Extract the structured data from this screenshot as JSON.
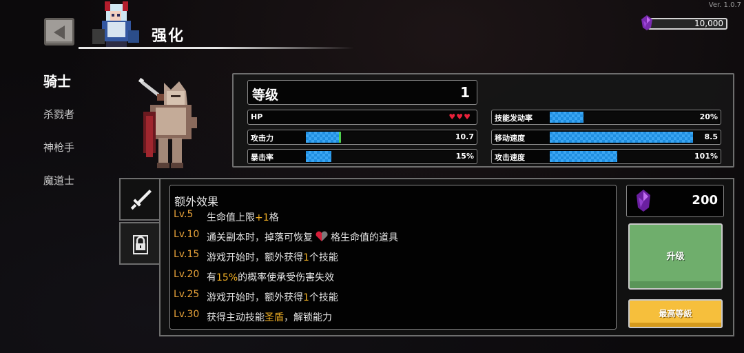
{
  "version": "Ver. 1.0.7",
  "header": {
    "title": "强化"
  },
  "currency": {
    "amount": "10,000",
    "icon": "purple-gem-icon"
  },
  "classes": [
    {
      "label": "骑士",
      "active": true
    },
    {
      "label": "杀戮者",
      "active": false
    },
    {
      "label": "神枪手",
      "active": false
    },
    {
      "label": "魔道士",
      "active": false
    }
  ],
  "stats": {
    "level_label": "等级",
    "level_value": "1",
    "hp": {
      "label": "HP",
      "hearts": "♥♥♥",
      "count": 3
    },
    "attack": {
      "label": "攻击力",
      "value": "10.7",
      "fill": 0.21
    },
    "crit": {
      "label": "暴击率",
      "value": "15%",
      "fill": 0.15
    },
    "skill_rate": {
      "label": "技能发动率",
      "value": "20%",
      "fill": 0.2
    },
    "move_speed": {
      "label": "移动速度",
      "value": "8.5",
      "fill": 0.85
    },
    "attack_speed": {
      "label": "攻击速度",
      "value": "101%",
      "fill": 0.4
    }
  },
  "effects": {
    "title": "额外效果",
    "items": [
      {
        "lv": "Lv.5",
        "pre": "生命值上限",
        "hl": "+1",
        "post": "格"
      },
      {
        "lv": "Lv.10",
        "pre": "通关副本时，掉落可恢复",
        "hl": "",
        "post": "格生命值的道具",
        "heart": true
      },
      {
        "lv": "Lv.15",
        "pre": "游戏开始时，额外获得",
        "hl": "1",
        "post": "个技能"
      },
      {
        "lv": "Lv.20",
        "pre": "有",
        "hl": "15%",
        "post": "的概率使承受伤害失效"
      },
      {
        "lv": "Lv.25",
        "pre": "游戏开始时，额外获得",
        "hl": "1",
        "post": "个技能"
      },
      {
        "lv": "Lv.30",
        "pre": "获得主动技能",
        "hl": "圣盾",
        "post": "，解锁能力"
      }
    ]
  },
  "cost": {
    "value": "200"
  },
  "buttons": {
    "upgrade": "升级",
    "max_level": "最高等級"
  },
  "colors": {
    "accent_orange": "#f2b024",
    "bar_blue": "#1f8ee0",
    "upgrade_green": "#6fae6c",
    "max_yellow": "#f6bf3c"
  }
}
